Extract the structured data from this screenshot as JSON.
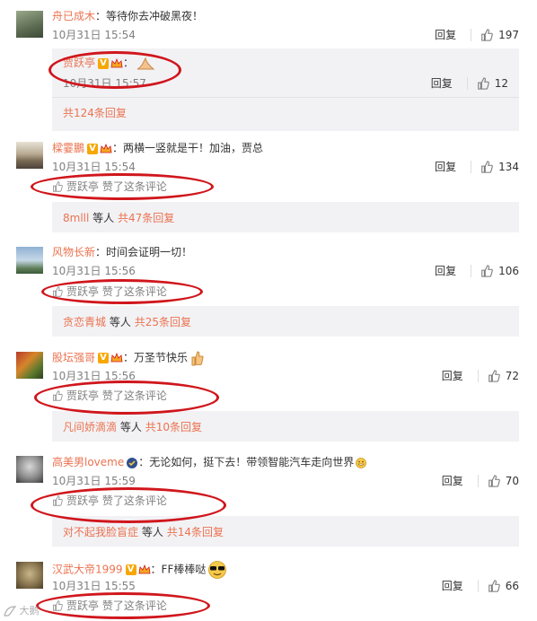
{
  "comments": [
    {
      "user": "舟已成木",
      "text": "：等待你去冲破黑夜！",
      "time": "10月31日 15:54",
      "reply": "回复",
      "likes": "197",
      "subreply": {
        "user": "贾跃亭",
        "text": "：",
        "time": "10月31日 15:57",
        "reply": "回复",
        "likes": "12"
      },
      "more": "共124条回复"
    },
    {
      "user": "樑霎鵬",
      "text": "：两横一竖就是干！加油，贾总",
      "time": "10月31日 15:54",
      "reply": "回复",
      "likes": "134",
      "liked_by": "贾跃亭 赞了这条评论",
      "more_user": "8mlll",
      "more_mid": "等人",
      "more_count": "共47条回复"
    },
    {
      "user": "风物长新",
      "text": "：时间会证明一切！",
      "time": "10月31日 15:56",
      "reply": "回复",
      "likes": "106",
      "liked_by": "贾跃亭 赞了这条评论",
      "more_user": "贪恋青城",
      "more_mid": "等人",
      "more_count": "共25条回复"
    },
    {
      "user": "股坛强哥",
      "text": "：万圣节快乐",
      "time": "10月31日 15:56",
      "reply": "回复",
      "likes": "72",
      "liked_by": "贾跃亭 赞了这条评论",
      "more_user": "凡间娇滴滴",
      "more_mid": "等人",
      "more_count": "共10条回复"
    },
    {
      "user": "高美男loveme",
      "text": "：无论如何，挺下去！带领智能汽车走向世界",
      "time": "10月31日 15:59",
      "reply": "回复",
      "likes": "70",
      "liked_by": "贾跃亭 赞了这条评论",
      "more_user": "对不起我脸盲症",
      "more_mid": "等人",
      "more_count": "共14条回复"
    },
    {
      "user": "汉武大帝1999",
      "text": "：FF棒棒哒",
      "time": "10月31日 15:55",
      "reply": "回复",
      "likes": "66",
      "liked_by": "贾跃亭 赞了这条评论"
    }
  ],
  "watermark": "大鹅",
  "colors": {
    "username": "#eb7350",
    "circle": "#d0161c",
    "subbg": "#f2f2f5"
  }
}
